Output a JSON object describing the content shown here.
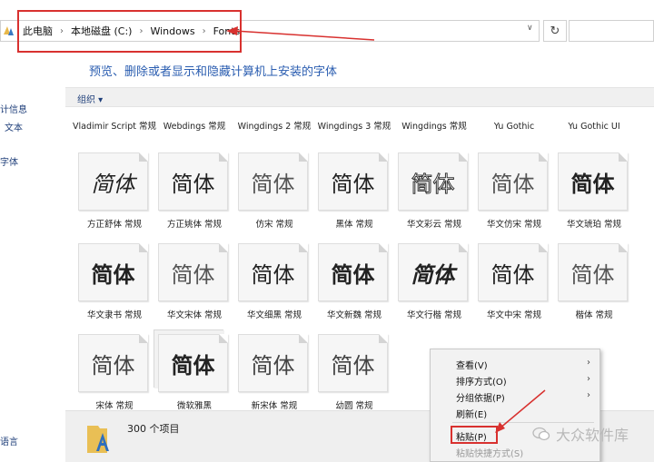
{
  "breadcrumb": [
    "此电脑",
    "本地磁盘 (C:)",
    "Windows",
    "Fonts"
  ],
  "heading": "预览、删除或者显示和隐藏计算机上安装的字体",
  "toolbar": {
    "organize": "组织 ▾"
  },
  "nav": {
    "items": [
      "计信息",
      "文本",
      "字体",
      "语言"
    ]
  },
  "fonts_row1": [
    {
      "label": "Vladimir Script 常规"
    },
    {
      "label": "Webdings 常规"
    },
    {
      "label": "Wingdings 2 常规"
    },
    {
      "label": "Wingdings 3 常规"
    },
    {
      "label": "Wingdings 常规"
    },
    {
      "label": "Yu Gothic"
    },
    {
      "label": "Yu Gothic UI"
    }
  ],
  "fonts_row2": [
    {
      "sample": "简体",
      "label": "方正舒体 常规"
    },
    {
      "sample": "简体",
      "label": "方正姚体 常规"
    },
    {
      "sample": "简体",
      "label": "仿宋 常规"
    },
    {
      "sample": "简体",
      "label": "黑体 常规"
    },
    {
      "sample": "简体",
      "label": "华文彩云 常规"
    },
    {
      "sample": "简体",
      "label": "华文仿宋 常规"
    },
    {
      "sample": "简体",
      "label": "华文琥珀 常规"
    }
  ],
  "fonts_row3": [
    {
      "sample": "简体",
      "label": "华文隶书 常规"
    },
    {
      "sample": "简体",
      "label": "华文宋体 常规"
    },
    {
      "sample": "简体",
      "label": "华文细黑 常规"
    },
    {
      "sample": "简体",
      "label": "华文新魏 常规"
    },
    {
      "sample": "简体",
      "label": "华文行楷 常规"
    },
    {
      "sample": "简体",
      "label": "华文中宋 常规"
    },
    {
      "sample": "简体",
      "label": "楷体 常规"
    }
  ],
  "fonts_row4": [
    {
      "sample": "简体",
      "label": "宋体 常规"
    },
    {
      "sample": "简体",
      "label": "微软雅黑"
    },
    {
      "sample": "简体",
      "label": "新宋体 常规"
    },
    {
      "sample": "简体",
      "label": "幼圆 常规"
    }
  ],
  "status": {
    "count": "300 个项目"
  },
  "context_menu": {
    "view": "查看(V)",
    "sort": "排序方式(O)",
    "group": "分组依据(P)",
    "refresh": "刷新(E)",
    "paste": "粘贴(P)",
    "paste_shortcut": "粘贴快捷方式(S)"
  },
  "watermark": "大众软件库",
  "colors": {
    "highlight_red": "#d8312f",
    "link_blue": "#2a5db0"
  }
}
